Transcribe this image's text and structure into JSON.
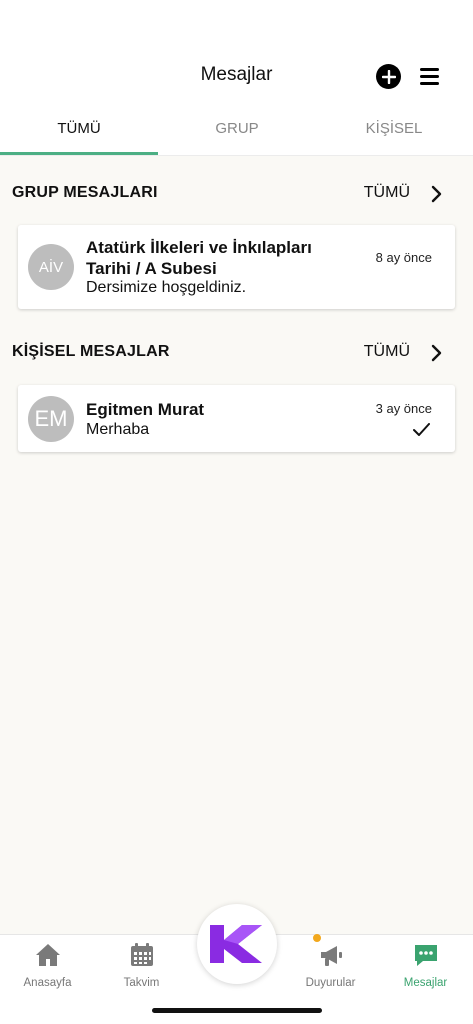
{
  "header": {
    "title": "Mesajlar"
  },
  "tabs": [
    {
      "label": "TÜMÜ",
      "active": true
    },
    {
      "label": "GRUP",
      "active": false
    },
    {
      "label": "KİŞİSEL",
      "active": false
    }
  ],
  "group_section": {
    "title": "GRUP MESAJLARI",
    "all_label": "TÜMÜ",
    "items": [
      {
        "initials": "AİV",
        "name_line1": "Atatürk İlkeleri ve İnkılapları",
        "name_line2": "Tarihi  / A Subesi",
        "message": "Dersimize hoşgeldiniz.",
        "time": "8 ay önce"
      }
    ]
  },
  "personal_section": {
    "title": "KİŞİSEL MESAJLAR",
    "all_label": "TÜMÜ",
    "items": [
      {
        "initials": "EM",
        "name": "Egitmen Murat",
        "message": "Merhaba",
        "time": "3 ay önce",
        "read": true
      }
    ]
  },
  "bottom_nav": [
    {
      "label": "Anasayfa",
      "icon": "home-icon",
      "active": false
    },
    {
      "label": "Takvim",
      "icon": "calendar-icon",
      "active": false
    },
    {
      "label": "Duyurular",
      "icon": "megaphone-icon",
      "active": false,
      "has_badge": true
    },
    {
      "label": "Mesajlar",
      "icon": "chat-icon",
      "active": true
    }
  ],
  "colors": {
    "accent": "#4caf84",
    "active_nav": "#3aa36f",
    "logo": "#8a2be2",
    "badge": "#f2a81d"
  }
}
